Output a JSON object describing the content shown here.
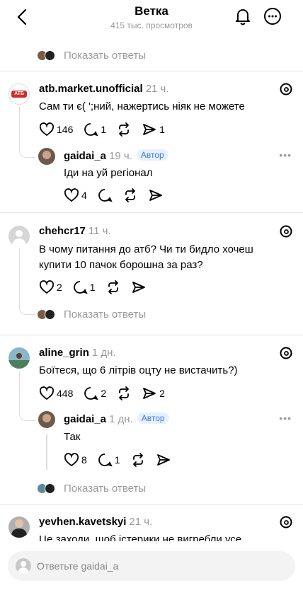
{
  "header": {
    "title": "Ветка",
    "subtitle": "415 тыс. просмотров"
  },
  "show_replies_label": "Показать ответы",
  "posts": [
    {
      "username": "atb.market.unofficial",
      "time": "21 ч.",
      "text": "Сам ти є(  ';ний, нажертись ніяк не можете",
      "likes": "146",
      "comments": "1",
      "reposts": "",
      "shares": "1"
    },
    {
      "username": "gaidai_a",
      "time": "19 ч.",
      "badge": "Автор",
      "text": "Іди на уй регіонал",
      "likes": "4"
    },
    {
      "username": "chehcr17",
      "time": "11 ч.",
      "text_line1": "В чому питання до атб? Чи ти бидло хочеш",
      "text_line2": "купити 10 пачок борошна за раз?",
      "likes": "2",
      "comments": "1"
    },
    {
      "username": "aline_grin",
      "time": "1 дн.",
      "text": "Боїтеся, що 6 літрів оцту не вистачить?)",
      "likes": "448",
      "comments": "2",
      "shares": "2"
    },
    {
      "username": "gaidai_a",
      "time": "1 дн.",
      "badge": "Автор",
      "text": "Так",
      "likes": "8",
      "comments": "1"
    },
    {
      "username": "yevhen.kavetskyi",
      "time": "21 ч.",
      "text": "Це заходи, щоб істерики не вигребли усе"
    }
  ],
  "reply": {
    "placeholder": "Ответьте gaidai_a"
  },
  "colors": {
    "badge_bg": "#e6f0ff",
    "badge_text": "#3d7bd9",
    "muted": "#999999"
  }
}
